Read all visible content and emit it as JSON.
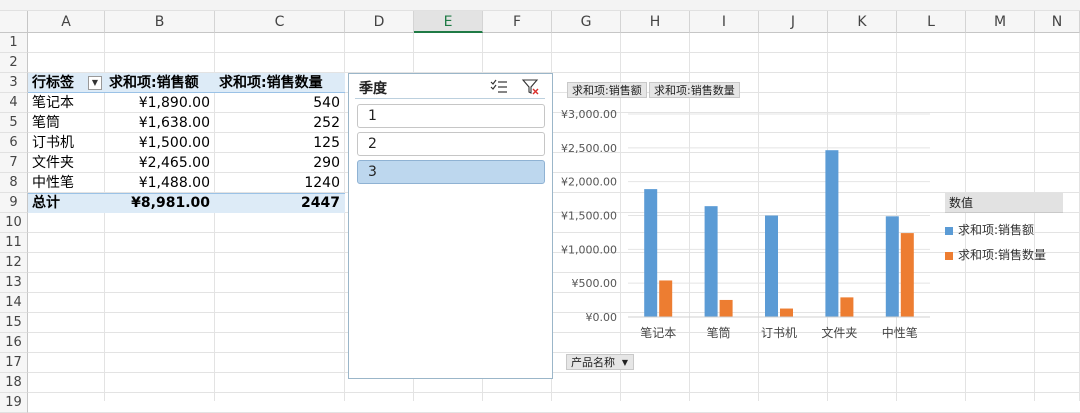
{
  "columns": [
    "A",
    "B",
    "C",
    "D",
    "E",
    "F",
    "G",
    "H",
    "I",
    "J",
    "K",
    "L",
    "M",
    "N"
  ],
  "selected_column": "E",
  "rows": [
    "1",
    "2",
    "3",
    "4",
    "5",
    "6",
    "7",
    "8",
    "9",
    "10",
    "11",
    "12",
    "13",
    "14",
    "15",
    "16",
    "17",
    "18",
    "19"
  ],
  "pivot": {
    "headers": {
      "row_label": "行标签",
      "sum_sales": "求和项:销售额",
      "sum_qty": "求和项:销售数量"
    },
    "rows": [
      {
        "label": "笔记本",
        "sales": "¥1,890.00",
        "qty": "540"
      },
      {
        "label": "笔筒",
        "sales": "¥1,638.00",
        "qty": "252"
      },
      {
        "label": "订书机",
        "sales": "¥1,500.00",
        "qty": "125"
      },
      {
        "label": "文件夹",
        "sales": "¥2,465.00",
        "qty": "290"
      },
      {
        "label": "中性笔",
        "sales": "¥1,488.00",
        "qty": "1240"
      }
    ],
    "total": {
      "label": "总计",
      "sales": "¥8,981.00",
      "qty": "2447"
    }
  },
  "slicer": {
    "title": "季度",
    "items": [
      {
        "label": "1",
        "selected": false
      },
      {
        "label": "2",
        "selected": false
      },
      {
        "label": "3",
        "selected": true
      }
    ]
  },
  "chart_data": {
    "type": "bar",
    "categories": [
      "笔记本",
      "笔筒",
      "订书机",
      "文件夹",
      "中性笔"
    ],
    "series": [
      {
        "name": "求和项:销售额",
        "values": [
          1890,
          1638,
          1500,
          2465,
          1488
        ],
        "color": "#5b9bd5"
      },
      {
        "name": "求和项:销售数量",
        "values": [
          540,
          252,
          125,
          290,
          1240
        ],
        "color": "#ed7d31"
      }
    ],
    "ylim": [
      0,
      3000
    ],
    "yticks": [
      "¥0.00",
      "¥500.00",
      "¥1,000.00",
      "¥1,500.00",
      "¥2,000.00",
      "¥2,500.00",
      "¥3,000.00"
    ],
    "grid": true,
    "legend_title": "数值",
    "legend_position": "right",
    "value_field_buttons": [
      "求和项:销售额",
      "求和项:销售数量"
    ],
    "axis_field_button": "产品名称"
  }
}
